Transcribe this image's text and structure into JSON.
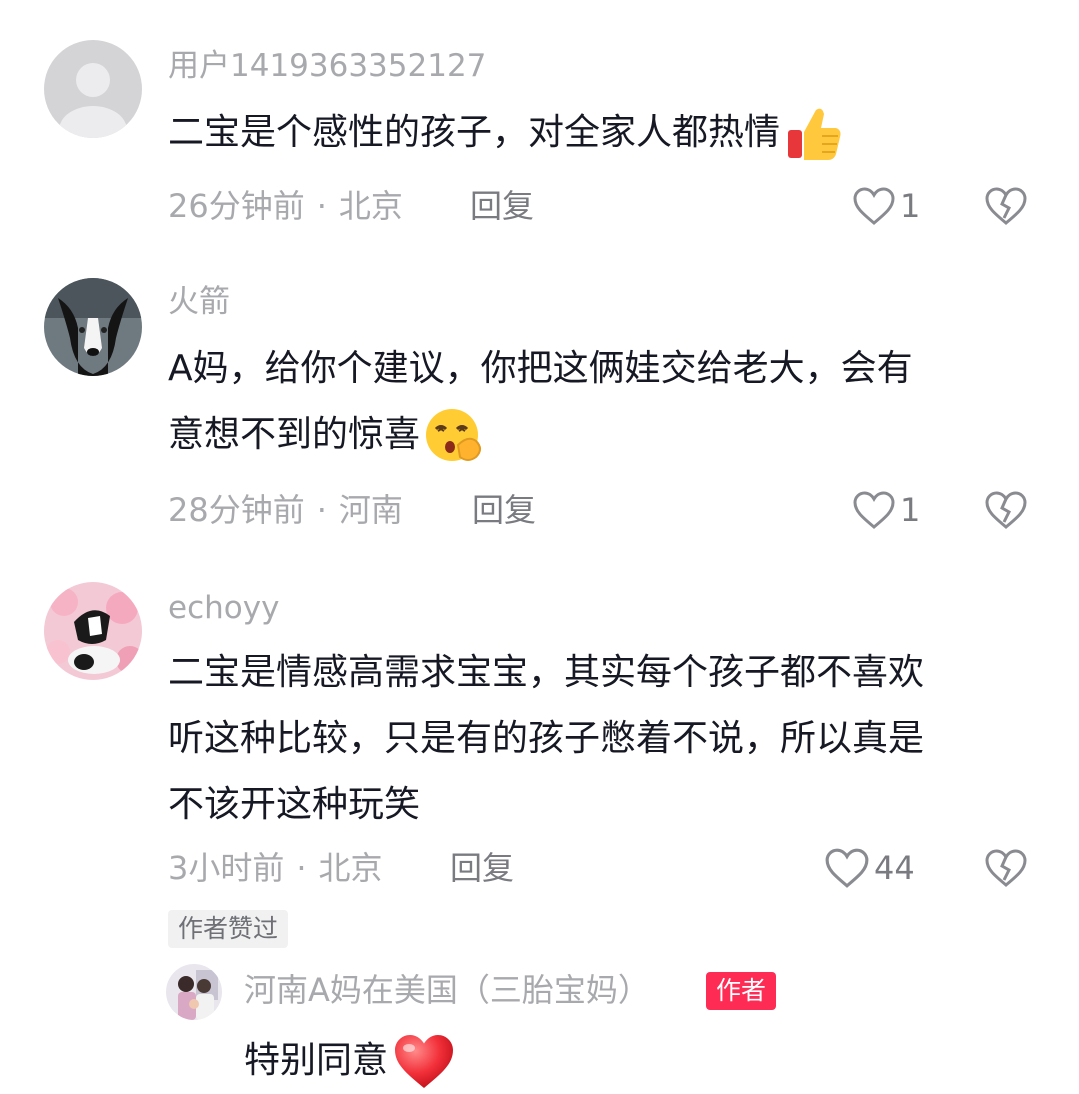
{
  "comments": [
    {
      "username": "用户1419363352127",
      "text": "二宝是个感性的孩子，对全家人都热情",
      "emoji": "thumbs-up-emoji",
      "time": "26分钟前",
      "location": "北京",
      "reply_label": "回复",
      "likes": "1"
    },
    {
      "username": "火箭",
      "text_line1": "A妈，给你个建议，你把这俩娃交给老大，会有",
      "text_line2": "意想不到的惊喜",
      "emoji": "shushing-face-emoji",
      "time": "28分钟前",
      "location": "河南",
      "reply_label": "回复",
      "likes": "1"
    },
    {
      "username": "echoyy",
      "text_lines": [
        "二宝是情感高需求宝宝，其实每个孩子都不喜欢",
        "听这种比较，只是有的孩子憋着不说，所以真是",
        "不该开这种玩笑"
      ],
      "time": "3小时前",
      "location": "北京",
      "reply_label": "回复",
      "likes": "44",
      "author_liked_badge": "作者赞过",
      "reply": {
        "username": "河南A妈在美国（三胎宝妈）",
        "author_tag": "作者",
        "text": "特别同意",
        "emoji": "red-heart-emoji"
      }
    }
  ],
  "dot": "·",
  "colors": {
    "text": "#161823",
    "muted": "#a8a9ad",
    "author_tag": "#fe2c55"
  }
}
